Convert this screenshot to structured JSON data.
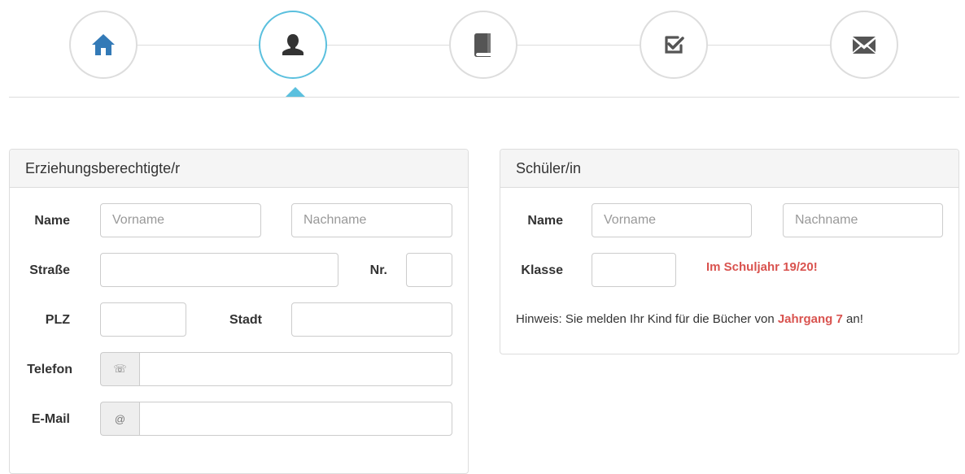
{
  "wizard": {
    "steps": [
      {
        "name": "home",
        "icon": "home-icon",
        "active": false
      },
      {
        "name": "person",
        "icon": "user-icon",
        "active": true
      },
      {
        "name": "book",
        "icon": "book-icon",
        "active": false
      },
      {
        "name": "check",
        "icon": "checkbox-icon",
        "active": false
      },
      {
        "name": "mail",
        "icon": "envelope-icon",
        "active": false
      }
    ],
    "colors": {
      "active_border": "#5bc0de",
      "home_icon": "#337ab7",
      "icon": "#555555"
    }
  },
  "guardian": {
    "title": "Erziehungsberechtigte/r",
    "name_label": "Name",
    "firstname_placeholder": "Vorname",
    "lastname_placeholder": "Nachname",
    "street_label": "Straße",
    "number_label": "Nr.",
    "zip_label": "PLZ",
    "city_label": "Stadt",
    "phone_label": "Telefon",
    "phone_addon": "☏",
    "email_label": "E-Mail",
    "email_addon": "@"
  },
  "student": {
    "title": "Schüler/in",
    "name_label": "Name",
    "firstname_placeholder": "Vorname",
    "lastname_placeholder": "Nachname",
    "class_label": "Klasse",
    "school_year_note": "Im Schuljahr 19/20!",
    "hint_prefix": "Hinweis: Sie melden Ihr Kind für die Bücher von ",
    "hint_grade": "Jahrgang 7",
    "hint_suffix": " an!",
    "accent_color": "#d9534f"
  }
}
